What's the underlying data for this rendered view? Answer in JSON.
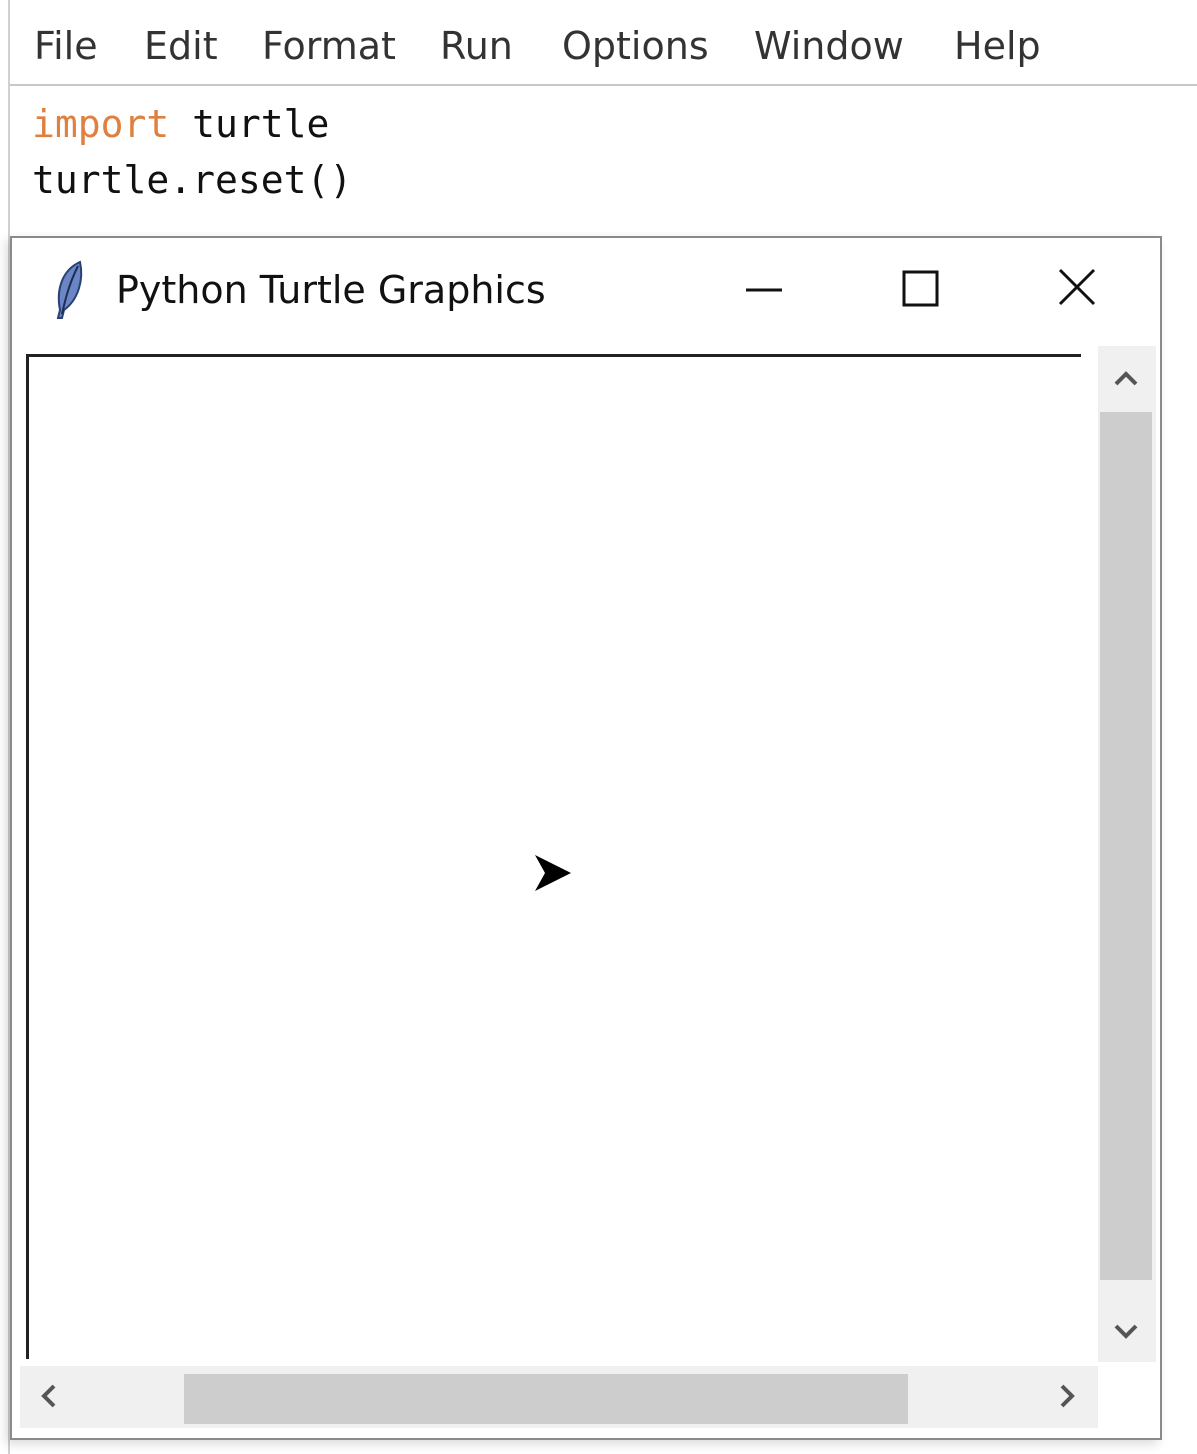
{
  "editor": {
    "menu": [
      "File",
      "Edit",
      "Format",
      "Run",
      "Options",
      "Window",
      "Help"
    ],
    "code": {
      "line1_keyword": "import",
      "line1_rest": " turtle",
      "line2": "turtle.reset()"
    }
  },
  "turtle_window": {
    "title": "Python Turtle Graphics",
    "icons": {
      "app": "feather-icon",
      "minimize": "minimize-icon",
      "maximize": "maximize-icon",
      "close": "close-icon",
      "cursor": "turtle-arrow-icon"
    }
  },
  "colors": {
    "keyword": "#e08040",
    "scroll_thumb": "#cdcdcd",
    "scroll_track": "#f0f0f0"
  }
}
